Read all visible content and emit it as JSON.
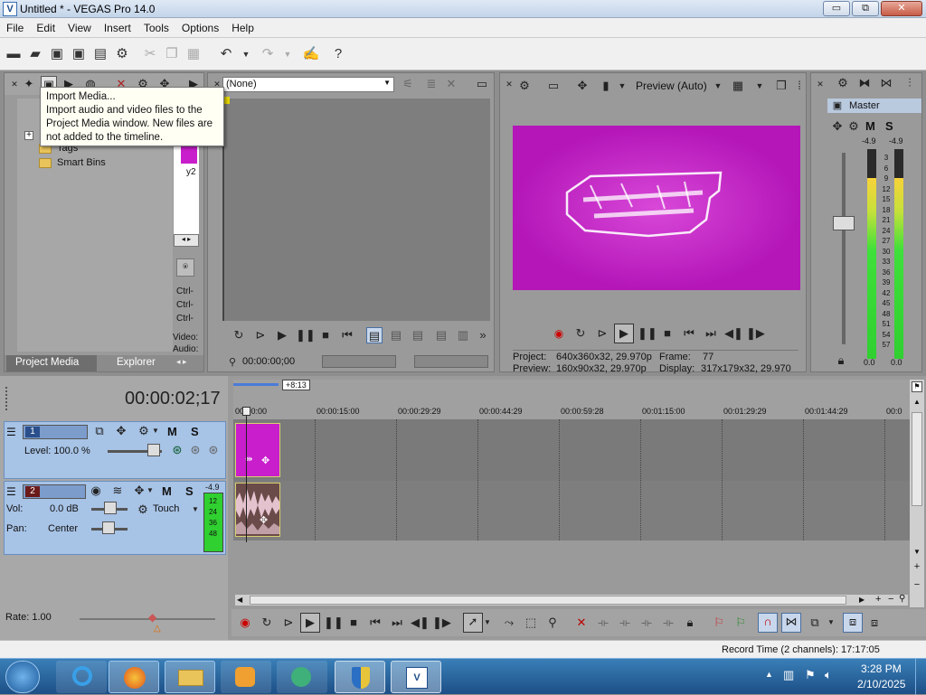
{
  "window": {
    "title": "Untitled * - VEGAS Pro 14.0",
    "logo": "V",
    "min": "▭",
    "max": "⧉",
    "close": "✕"
  },
  "menu": [
    "File",
    "Edit",
    "View",
    "Insert",
    "Tools",
    "Options",
    "Help"
  ],
  "tooltip": {
    "title": "Import Media...",
    "body": "Import audio and video files to the Project Media window. New files are not added to the timeline."
  },
  "project_media": {
    "tree": [
      "Tags",
      "Smart Bins"
    ],
    "expand": "+",
    "tabs": [
      "Project Media",
      "Explorer"
    ],
    "side_labels": [
      "Ctrl-",
      "Ctrl-",
      "Ctrl-",
      "Video:",
      "Audio:"
    ],
    "thumb_label": "y2"
  },
  "trimmer": {
    "dropdown": "(None)",
    "timecode": "00:00:00;00"
  },
  "preview": {
    "mode": "Preview (Auto)",
    "project_label": "Project:",
    "project": "640x360x32, 29.970p",
    "frame_label": "Frame:",
    "frame": "77",
    "preview_label": "Preview:",
    "preview": "160x90x32, 29.970p",
    "display_label": "Display:",
    "display": "317x179x32, 29.970"
  },
  "master": {
    "label": "Master",
    "m": "M",
    "s": "S",
    "peak_left": "-4.9",
    "peak_right": "-4.9",
    "scale": [
      "3",
      "6",
      "9",
      "12",
      "15",
      "18",
      "21",
      "24",
      "27",
      "30",
      "33",
      "36",
      "39",
      "42",
      "45",
      "48",
      "51",
      "54",
      "57"
    ],
    "bottom_left": "0.0",
    "bottom_right": "0.0"
  },
  "timeline": {
    "timecode": "00:00:02;17",
    "offset": "+8:13",
    "ruler": [
      "00:00:00",
      "00:00:15:00",
      "00:00:29:29",
      "00:00:44:29",
      "00:00:59:28",
      "00:01:15:00",
      "00:01:29:29",
      "00:01:44:29",
      "00:0"
    ],
    "video_track": {
      "num": "1",
      "level": "Level: 100.0 %",
      "m": "M",
      "s": "S"
    },
    "audio_track": {
      "num": "2",
      "vol_label": "Vol:",
      "vol": "0.0 dB",
      "pan_label": "Pan:",
      "pan": "Center",
      "touch": "Touch",
      "m": "M",
      "s": "S",
      "meter_peak": "-4.9",
      "meter_scale": [
        "12",
        "24",
        "36",
        "48"
      ]
    },
    "rate": "Rate: 1.00"
  },
  "status": {
    "record_time": "Record Time (2 channels): 17:17:05"
  },
  "taskbar": {
    "time": "3:28 PM",
    "date": "2/10/2025"
  },
  "colors": {
    "accent_magenta": "#c81ecb",
    "track_blue": "#a7c3e6",
    "meter_green": "#2fd030"
  }
}
